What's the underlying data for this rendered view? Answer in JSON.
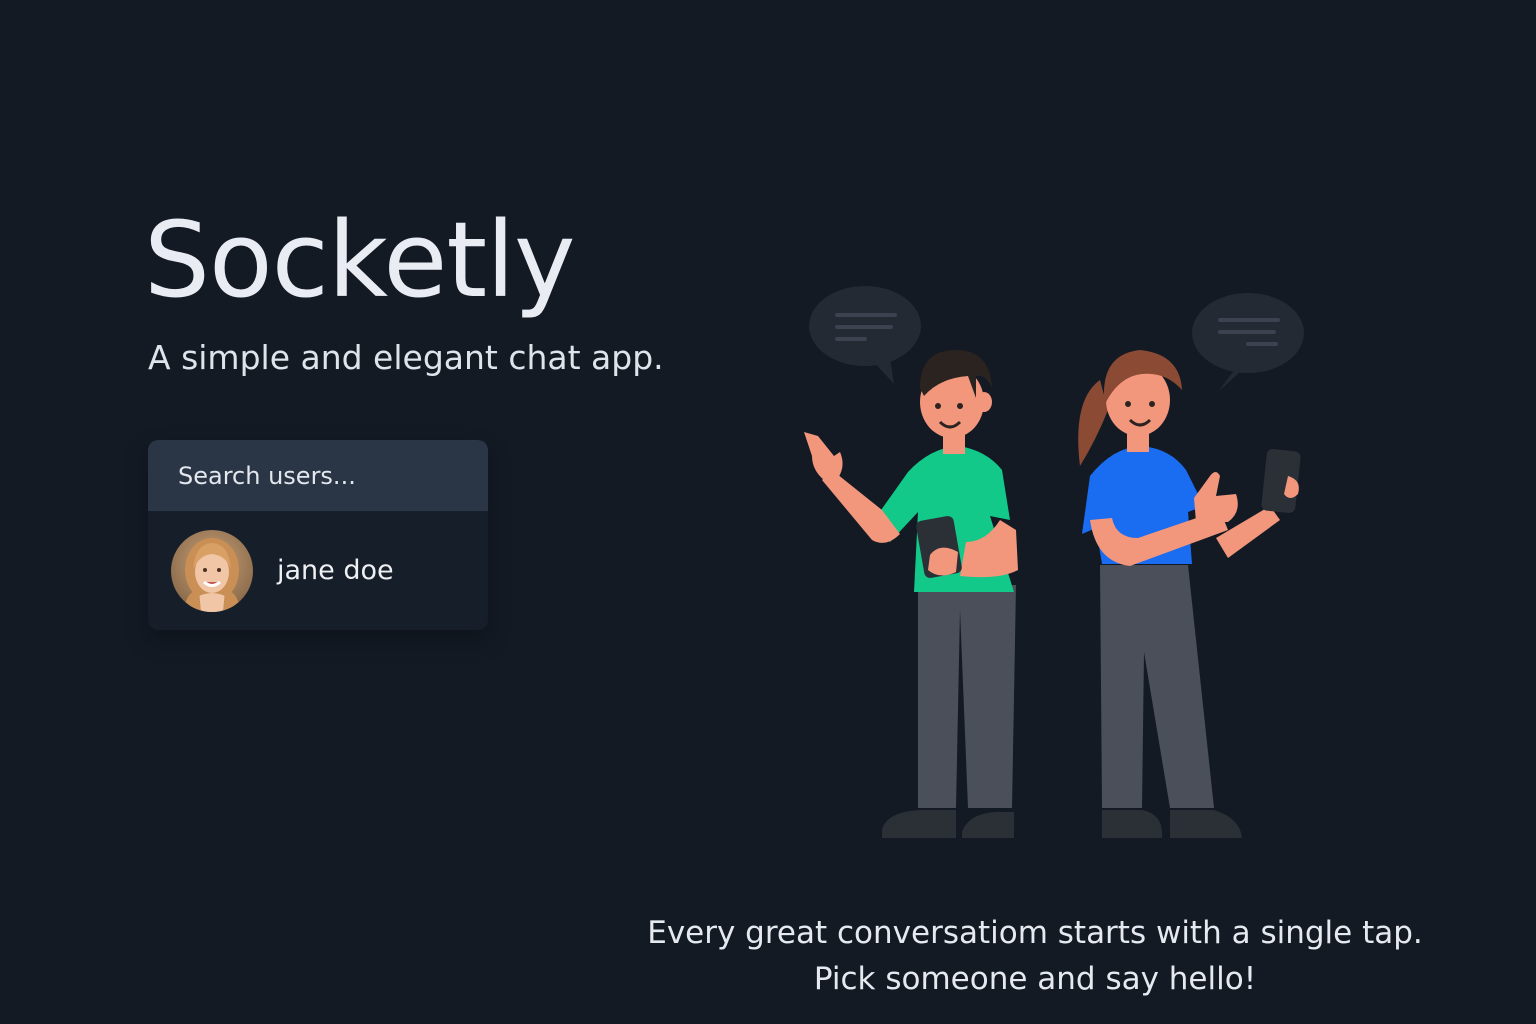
{
  "app": {
    "title": "Socketly",
    "tagline": "A simple and elegant chat app."
  },
  "search": {
    "placeholder": "Search users..."
  },
  "users": [
    {
      "name": "jane doe",
      "avatar_icon": "user-avatar-photo"
    }
  ],
  "footer": {
    "line1": "Every great conversatiom starts with a single tap.",
    "line2": "Pick someone and say hello!"
  },
  "colors": {
    "background": "#131a24",
    "search_bg": "#2a3545",
    "panel_bg": "#161e29",
    "man_shirt": "#12c98a",
    "woman_shirt": "#1a6cf0",
    "pants": "#4a4f5a"
  }
}
